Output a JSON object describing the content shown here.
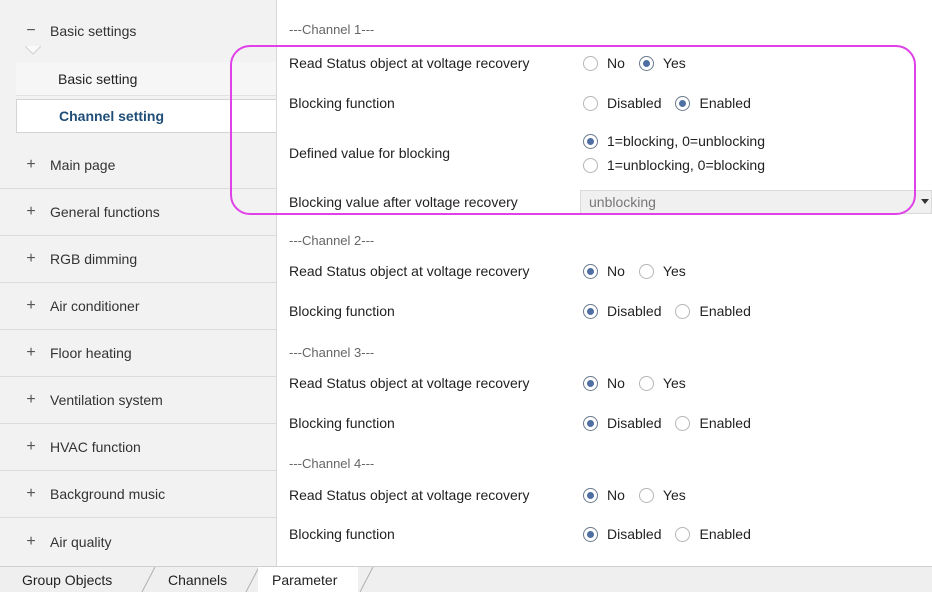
{
  "sidebar": {
    "basic_settings": {
      "sign": "−",
      "label": "Basic settings"
    },
    "sub_items": [
      "Basic setting",
      "Channel setting"
    ],
    "items": [
      {
        "sign": "+",
        "label": "Main page"
      },
      {
        "sign": "+",
        "label": "General functions"
      },
      {
        "sign": "+",
        "label": "RGB dimming"
      },
      {
        "sign": "+",
        "label": "Air conditioner"
      },
      {
        "sign": "+",
        "label": "Floor heating"
      },
      {
        "sign": "+",
        "label": "Ventilation system"
      },
      {
        "sign": "+",
        "label": "HVAC function"
      },
      {
        "sign": "+",
        "label": "Background music"
      },
      {
        "sign": "+",
        "label": "Air quality"
      }
    ]
  },
  "channels": [
    {
      "header": "---Channel 1---"
    },
    {
      "header": "---Channel 2---"
    },
    {
      "header": "---Channel 3---"
    },
    {
      "header": "---Channel 4---"
    }
  ],
  "params": {
    "read_status_label": "Read Status object at voltage recovery",
    "blocking_label": "Blocking function",
    "defined_value_label": "Defined value for blocking",
    "blocking_after_label": "Blocking value after voltage recovery",
    "opt_no": "No",
    "opt_yes": "Yes",
    "opt_disabled": "Disabled",
    "opt_enabled": "Enabled",
    "opt_block1": "1=blocking, 0=unblocking",
    "opt_block2": "1=unblocking, 0=blocking",
    "blocking_after_value": "unblocking"
  },
  "state": {
    "ch1": {
      "read_status": "Yes",
      "blocking": "Enabled",
      "defined": "1=blocking, 0=unblocking"
    },
    "ch2": {
      "read_status": "No",
      "blocking": "Disabled"
    },
    "ch3": {
      "read_status": "No",
      "blocking": "Disabled"
    },
    "ch4": {
      "read_status": "No",
      "blocking": "Disabled"
    }
  },
  "tabs": [
    "Group Objects",
    "Channels",
    "Parameter"
  ],
  "active_tab": "Parameter",
  "colors": {
    "highlight": "#e040e8",
    "active_sub": "#1f4e79",
    "radio_dot": "#4f6fa2"
  }
}
